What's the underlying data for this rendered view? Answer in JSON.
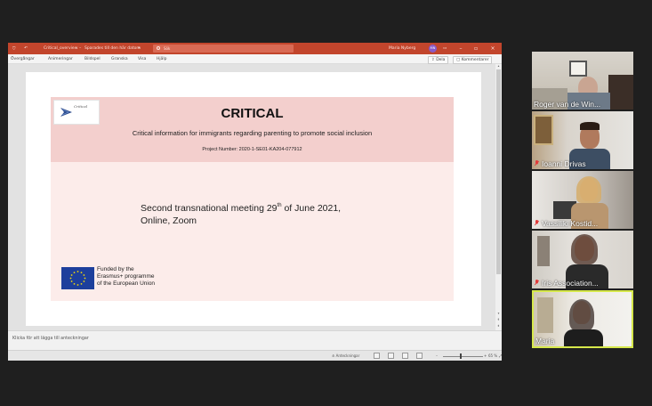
{
  "window": {
    "title_parts": [
      "Critical_overview",
      "Sparades till den här datorn"
    ],
    "search_text": "Sök",
    "user_name": "Maria Nyberg",
    "user_initials": "MN",
    "minimize": "–",
    "maximize": "▫",
    "close": "×",
    "accent_color": "#c2452c"
  },
  "menu": {
    "items": [
      "Övergångar",
      "Animeringar",
      "Bildspel",
      "Granska",
      "Visa",
      "Hjälp"
    ],
    "share_label": "Dela",
    "comments_label": "Kommentarer"
  },
  "slide": {
    "logo_text": "Critical",
    "title": "CRITICAL",
    "subtitle": "Critical information for immigrants regarding parenting to promote social inclusion",
    "project_number": "Project Number: 2020-1-SE01-KA204-077912",
    "meeting_line1_pre": "Second transnational meeting 29",
    "meeting_line1_sup": "th",
    "meeting_line1_post": " of June 2021,",
    "meeting_line2": "Online, Zoom",
    "funded_lines": [
      "Funded by the",
      "Erasmus+ programme",
      "of the European Union"
    ]
  },
  "notes": {
    "placeholder": "Klicka för att lägga till anteckningar"
  },
  "statusbar": {
    "notes_label": "Anteckningar",
    "zoom": "65 %"
  },
  "participants": [
    {
      "name": "Roger van de Win...",
      "muted": false
    },
    {
      "name": "Ioanni Drivas",
      "muted": true
    },
    {
      "name": "Vassiliki Kostid...",
      "muted": true
    },
    {
      "name": "Iris Association...",
      "muted": true
    },
    {
      "name": "Maria",
      "muted": false,
      "active": true
    }
  ]
}
